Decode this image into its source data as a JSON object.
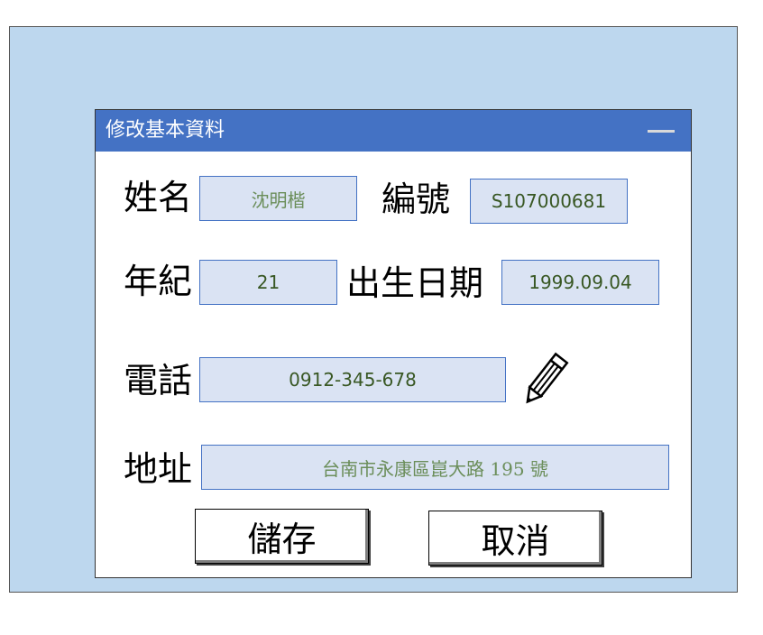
{
  "dialog": {
    "title": "修改基本資料"
  },
  "form": {
    "name_label": "姓名",
    "name_value": "沈明楷",
    "id_label": "編號",
    "id_value": "S107000681",
    "age_label": "年紀",
    "age_value": "21",
    "birth_label": "出生日期",
    "birth_value": "1999.09.04",
    "phone_label": "電話",
    "phone_value": "0912-345-678",
    "address_label": "地址",
    "address_value": "台南市永康區崑大路 195 號"
  },
  "buttons": {
    "save": "儲存",
    "cancel": "取消"
  },
  "icons": {
    "edit": "pencil-icon",
    "minimize": "minimize-icon"
  },
  "colors": {
    "background_panel": "#bdd7ee",
    "titlebar": "#4472c4",
    "field_fill": "#dae3f3",
    "field_text": "#385723"
  }
}
